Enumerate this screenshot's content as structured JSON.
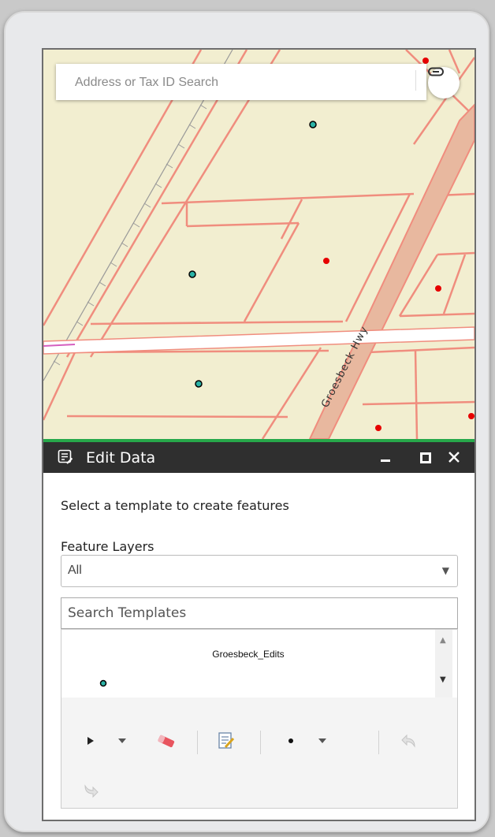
{
  "search": {
    "placeholder": "Address or Tax ID Search",
    "icon": "link-icon"
  },
  "map": {
    "road_label": "Groesbeck Hwy",
    "colors": {
      "background": "#f2eed0",
      "parcel_line": "#f08d7e",
      "highway_fill": "#e8b89f",
      "point_red": "#e60000",
      "point_teal": "#2bb3a6"
    }
  },
  "panel": {
    "title": "Edit Data",
    "title_icon": "edit-list-icon",
    "minimize_icon": "minimize-icon",
    "maximize_icon": "maximize-icon",
    "close_icon": "close-icon",
    "header_color": "#2f2f2f",
    "accent_color": "#27a84a"
  },
  "editor": {
    "instructions": "Select a template to create features",
    "feature_layers_label": "Feature Layers",
    "feature_layers_selected": "All",
    "search_templates_placeholder": "Search Templates",
    "template_group_title": "Groesbeck_Edits"
  },
  "toolbar": {
    "tools": [
      {
        "name": "select-tool",
        "icon": "pointer-icon",
        "has_dropdown": true
      },
      {
        "name": "clear-selection",
        "icon": "eraser-icon"
      },
      {
        "name": "attributes",
        "icon": "attributes-edit-icon"
      },
      {
        "name": "point-tool",
        "icon": "point-icon",
        "has_dropdown": true
      },
      {
        "name": "undo",
        "icon": "undo-icon",
        "enabled": false
      },
      {
        "name": "redo",
        "icon": "redo-icon",
        "enabled": false
      }
    ]
  }
}
